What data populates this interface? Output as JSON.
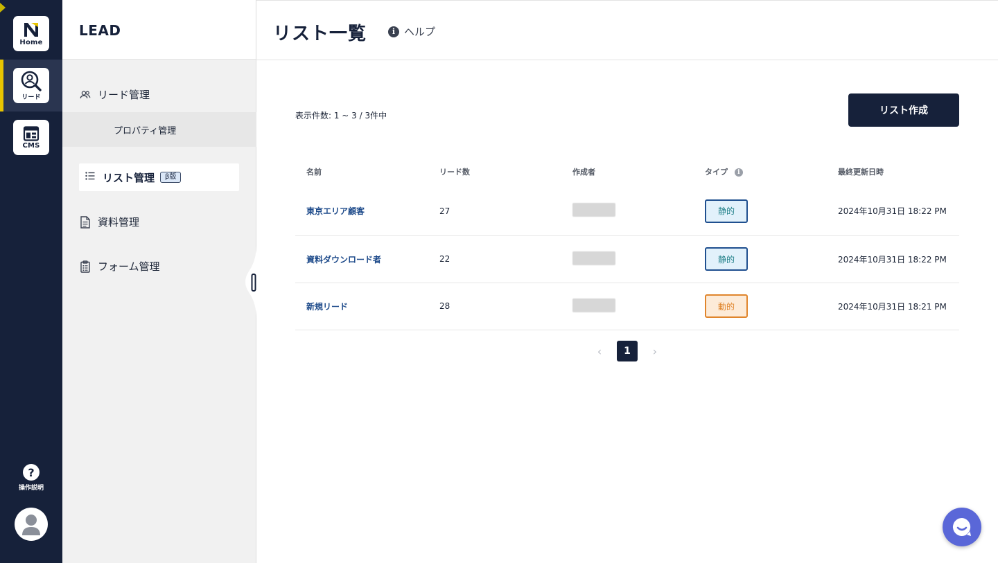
{
  "rail": {
    "apps": [
      {
        "label": "Home",
        "icon": "home-logo-icon"
      },
      {
        "label": "リード",
        "icon": "lead-search-icon"
      },
      {
        "label": "CMS",
        "icon": "cms-layout-icon"
      }
    ],
    "help_label": "操作説明",
    "help_glyph": "?",
    "accent_color": "#e8c400",
    "bg_color": "#16213a"
  },
  "sidebar": {
    "brand": "LEAD",
    "items": [
      {
        "label": "リード管理",
        "icon": "users-icon"
      },
      {
        "label": "プロパティ管理"
      },
      {
        "label": "リスト管理",
        "badge": "β版",
        "icon": "list-icon",
        "active": true
      },
      {
        "label": "資料管理",
        "icon": "document-icon"
      },
      {
        "label": "フォーム管理",
        "icon": "clipboard-icon"
      }
    ]
  },
  "header": {
    "title": "リスト一覧",
    "help_label": "ヘルプ",
    "help_glyph": "i"
  },
  "main": {
    "count_text": "表示件数: 1 ~ 3 / 3件中",
    "create_button": "リスト作成",
    "columns": [
      "名前",
      "リード数",
      "作成者",
      "タイプ",
      "最終更新日時"
    ],
    "type_info_glyph": "i",
    "rows": [
      {
        "name": "東京エリア顧客",
        "count": "27",
        "type": "静的",
        "type_kind": "static",
        "updated": "2024年10月31日 18:22 PM"
      },
      {
        "name": "資料ダウンロード者",
        "count": "22",
        "type": "静的",
        "type_kind": "static",
        "updated": "2024年10月31日 18:22 PM"
      },
      {
        "name": "新規リード",
        "count": "28",
        "type": "動的",
        "type_kind": "dynamic",
        "updated": "2024年10月31日 18:21 PM"
      }
    ],
    "badge_colors": {
      "static": {
        "bg": "#e2f1fb",
        "border": "#1f4f8f",
        "text": "#1f7f88"
      },
      "dynamic": {
        "bg": "#fdebd8",
        "border": "#e0852c",
        "text": "#e0852c"
      }
    },
    "pagination": {
      "prev": "‹",
      "current": "1",
      "next": "›"
    }
  },
  "chat": {
    "icon": "chat-bubble-icon",
    "color": "#5a67d8"
  }
}
